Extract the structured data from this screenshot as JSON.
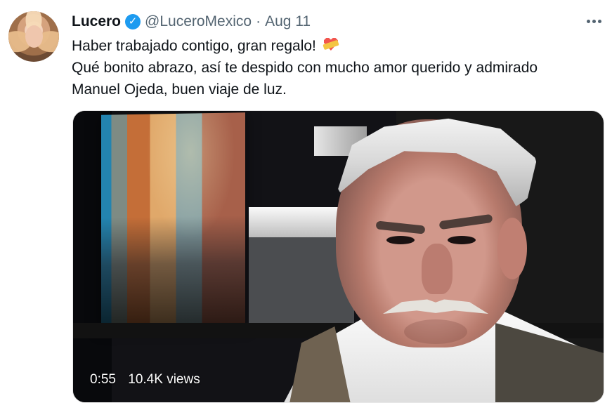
{
  "tweet": {
    "author_name": "Lucero",
    "verified": true,
    "handle": "@LuceroMexico",
    "separator": "·",
    "date": "Aug 11",
    "text_line_1": "Haber trabajado contigo, gran regalo!",
    "text_line_2": "Qué bonito abrazo, así te despido con mucho amor querido y admirado",
    "text_line_3": "Manuel Ojeda, buen viaje de luz."
  },
  "media": {
    "duration": "0:55",
    "views": "10.4K views"
  },
  "icons": {
    "verified": "verified-badge-icon",
    "more": "more-options-icon",
    "emoji": "heart-ribbon-emoji-icon"
  },
  "colors": {
    "twitter_blue": "#1d9bf0",
    "secondary_text": "#536471"
  }
}
